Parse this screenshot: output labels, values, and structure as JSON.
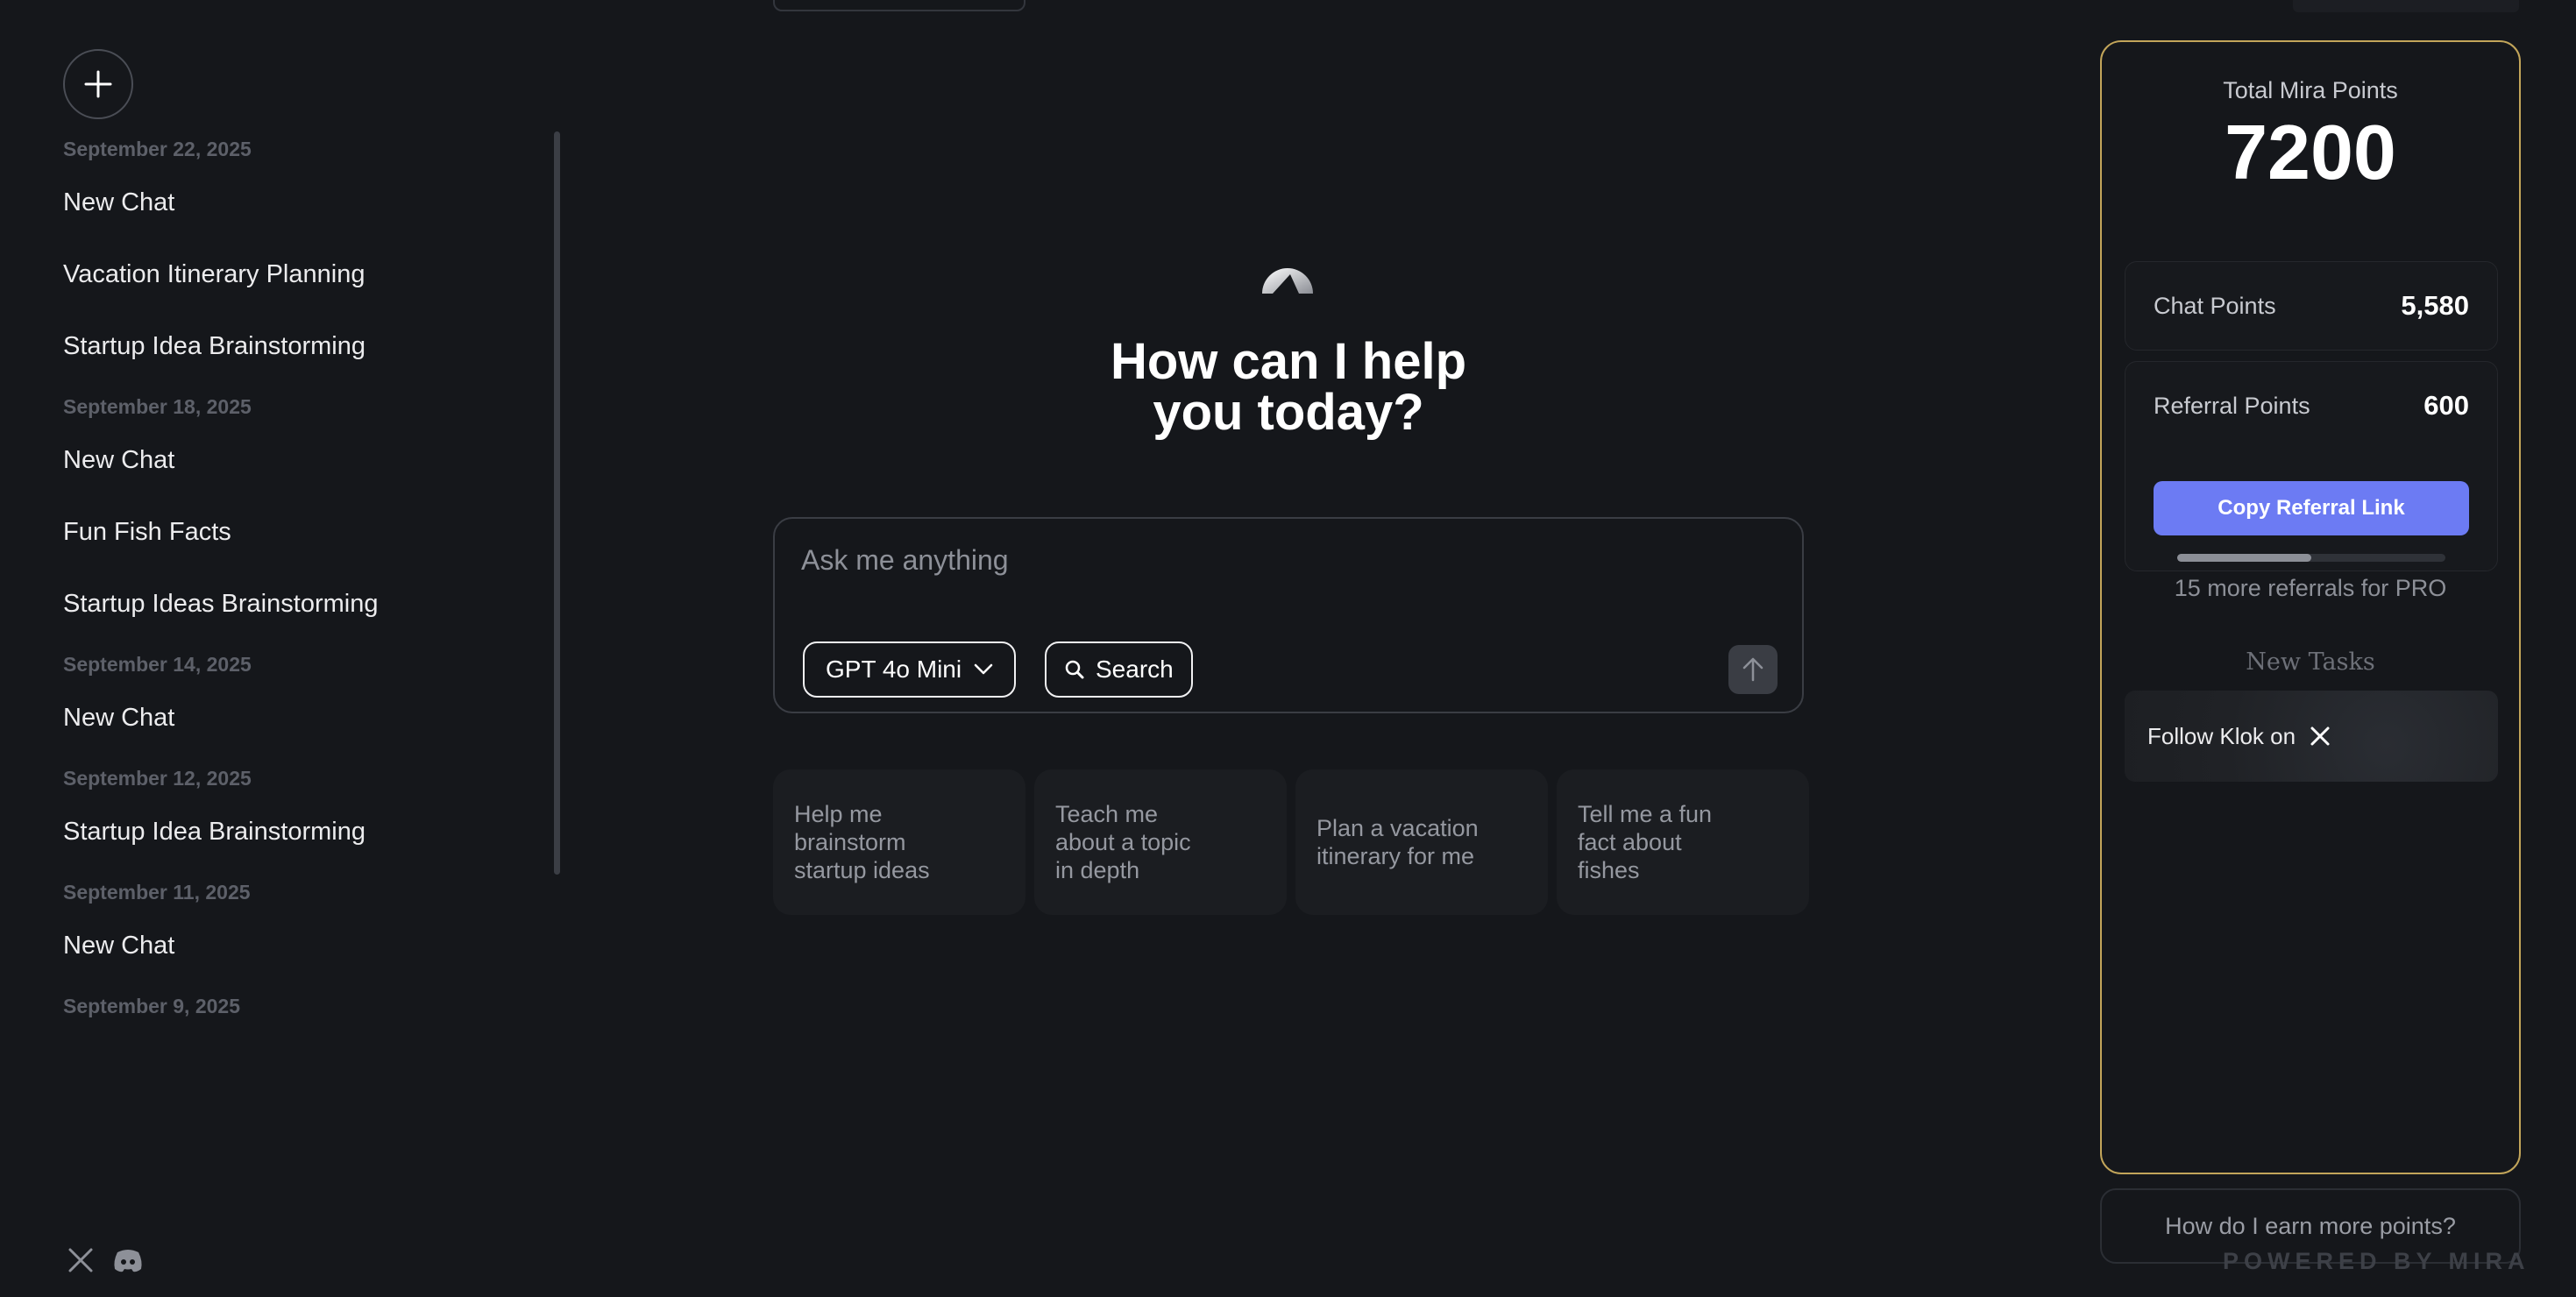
{
  "sidebar": {
    "groups": [
      {
        "date": "September 22, 2025",
        "items": [
          "New Chat",
          "Vacation Itinerary Planning",
          "Startup Idea Brainstorming"
        ]
      },
      {
        "date": "September 18, 2025",
        "items": [
          "New Chat",
          "Fun Fish Facts",
          "Startup Ideas Brainstorming"
        ]
      },
      {
        "date": "September 14, 2025",
        "items": [
          "New Chat"
        ]
      },
      {
        "date": "September 12, 2025",
        "items": [
          "Startup Idea Brainstorming"
        ]
      },
      {
        "date": "September 11, 2025",
        "items": [
          "New Chat"
        ]
      },
      {
        "date": "September 9, 2025",
        "items": []
      }
    ],
    "new_chat_icon": "plus-icon",
    "social_icons": [
      "x-icon",
      "discord-icon"
    ]
  },
  "main": {
    "headline_line1": "How can I help",
    "headline_line2": "you today?",
    "composer": {
      "placeholder": "Ask me anything",
      "model": "GPT 4o Mini",
      "search_label": "Search"
    },
    "suggestions": [
      "Help me\nbrainstorm\nstartup ideas",
      "Teach me\nabout a topic\nin depth",
      "Plan a vacation\nitinerary for me",
      "Tell me a fun\nfact about\nfishes"
    ]
  },
  "points": {
    "title": "Total Mira Points",
    "total": "7200",
    "chat_label": "Chat Points",
    "chat_value": "5,580",
    "referral_label": "Referral Points",
    "referral_value": "600",
    "copy_button": "Copy Referral Link",
    "progress_fraction": 0.5,
    "progress_text": "15 more referrals for PRO",
    "tasks_header": "New Tasks",
    "task_label": "Follow Klok on",
    "earn_button": "How do I earn more points?",
    "powered_by": "POWERED BY MIRA"
  },
  "colors": {
    "background": "#15171b",
    "accent": "#6c7bf3",
    "panel_border": "#c2a55a"
  }
}
